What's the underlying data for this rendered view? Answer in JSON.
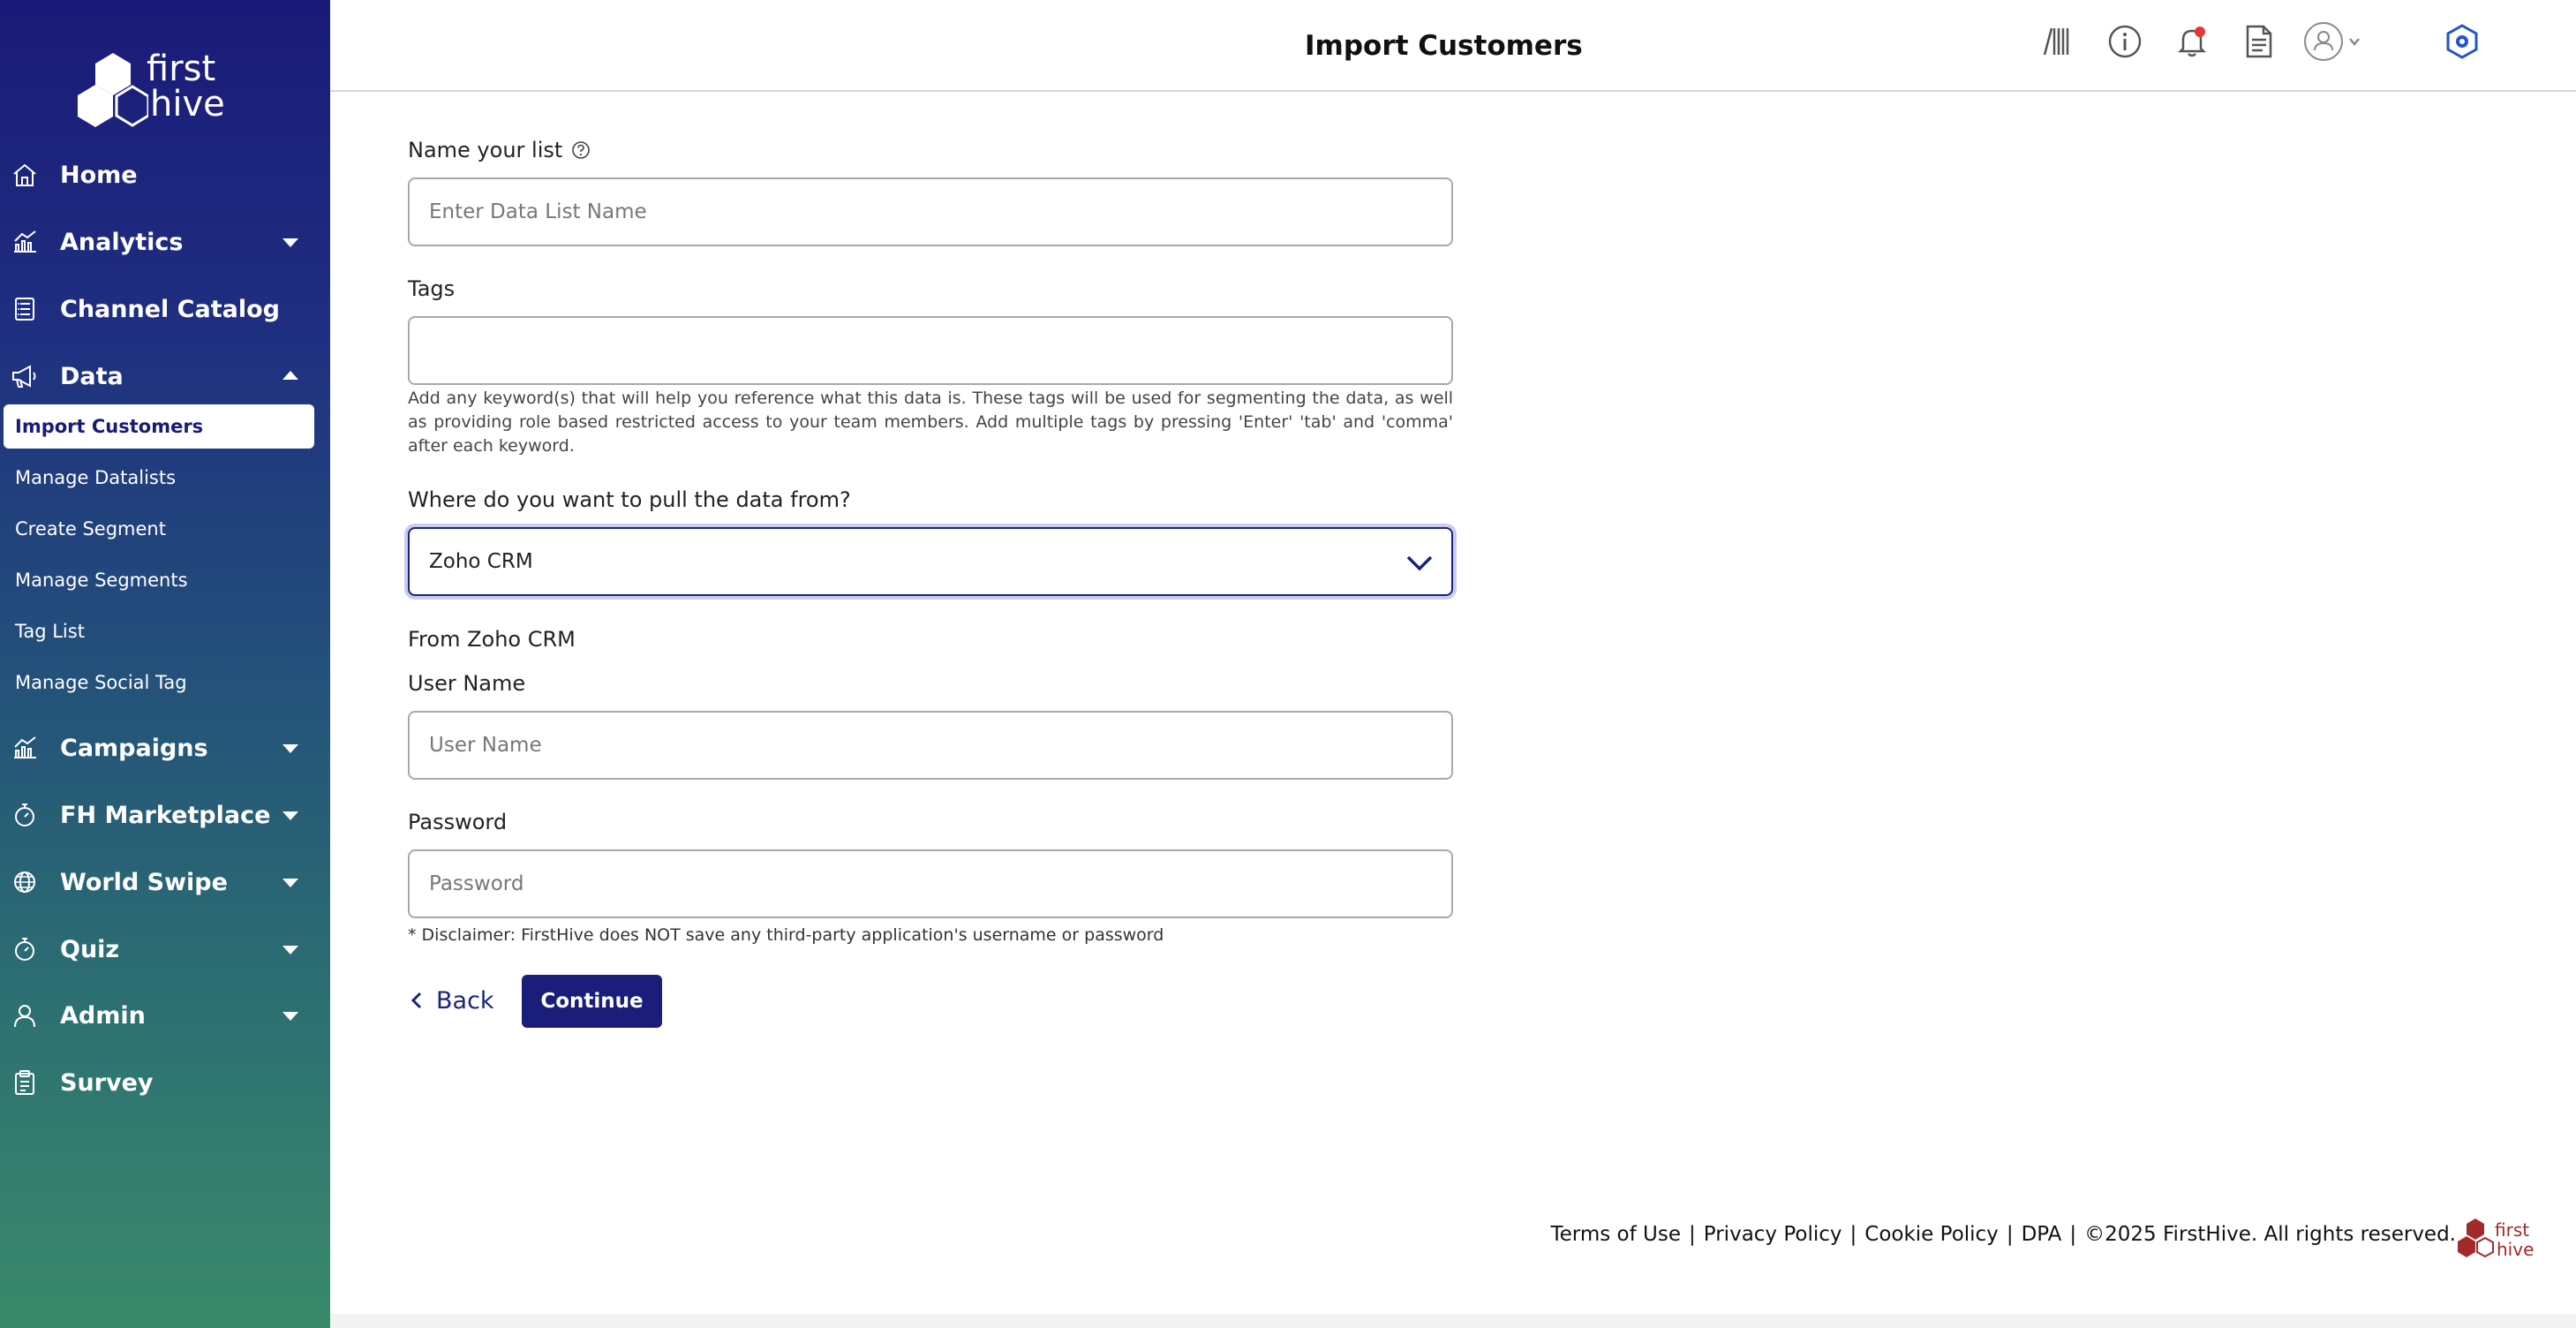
{
  "app": {
    "logo_line1": "first",
    "logo_line2": "hive"
  },
  "sidebar": {
    "items": [
      {
        "label": "Home",
        "icon": "home-icon",
        "caret": "none"
      },
      {
        "label": "Analytics",
        "icon": "analytics-icon",
        "caret": "down"
      },
      {
        "label": "Channel Catalog",
        "icon": "catalog-icon",
        "caret": "none"
      },
      {
        "label": "Data",
        "icon": "megaphone-icon",
        "caret": "up"
      },
      {
        "label": "Campaigns",
        "icon": "campaigns-icon",
        "caret": "down"
      },
      {
        "label": "FH Marketplace",
        "icon": "stopwatch-icon",
        "caret": "down"
      },
      {
        "label": "World Swipe",
        "icon": "globe-icon",
        "caret": "down"
      },
      {
        "label": "Quiz",
        "icon": "stopwatch-icon",
        "caret": "down"
      },
      {
        "label": "Admin",
        "icon": "user-icon",
        "caret": "down"
      },
      {
        "label": "Survey",
        "icon": "clipboard-icon",
        "caret": "none"
      }
    ],
    "data_subitems": [
      {
        "label": "Import Customers",
        "active": true
      },
      {
        "label": "Manage Datalists",
        "active": false
      },
      {
        "label": "Create Segment",
        "active": false
      },
      {
        "label": "Manage Segments",
        "active": false
      },
      {
        "label": "Tag List",
        "active": false
      },
      {
        "label": "Manage Social Tag",
        "active": false
      }
    ]
  },
  "header": {
    "title": "Import Customers",
    "icons": [
      "barcode-icon",
      "info-icon",
      "bell-icon",
      "document-icon",
      "profile-icon",
      "hexagon-settings-icon"
    ]
  },
  "form": {
    "list_name_label": "Name your list",
    "list_name_placeholder": "Enter Data List Name",
    "list_name_value": "",
    "tags_label": "Tags",
    "tags_value": "",
    "tags_help": "Add any keyword(s) that will help you reference what this data is. These tags will be used for segmenting the data, as well as providing role based restricted access to your team members. Add multiple tags by pressing 'Enter' 'tab' and 'comma' after each keyword.",
    "source_label": "Where do you want to pull the data from?",
    "source_selected": "Zoho CRM",
    "from_label": "From Zoho CRM",
    "username_label": "User Name",
    "username_placeholder": "User Name",
    "password_label": "Password",
    "password_placeholder": "Password",
    "disclaimer": "* Disclaimer: FirstHive does NOT save any third-party application's username or password",
    "back_label": "Back",
    "continue_label": "Continue"
  },
  "footer": {
    "terms": "Terms of Use",
    "privacy": "Privacy Policy",
    "cookie": "Cookie Policy",
    "dpa": "DPA",
    "copyright": "©2025 FirstHive. All rights reserved.",
    "logo_line1": "first",
    "logo_line2": "hive"
  },
  "colors": {
    "sidebar_top": "#1a1a78",
    "sidebar_bottom": "#3a8a6a",
    "primary_button": "#1a1e7a",
    "footer_logo": "#a32a2a",
    "notification_dot": "#e53935"
  }
}
